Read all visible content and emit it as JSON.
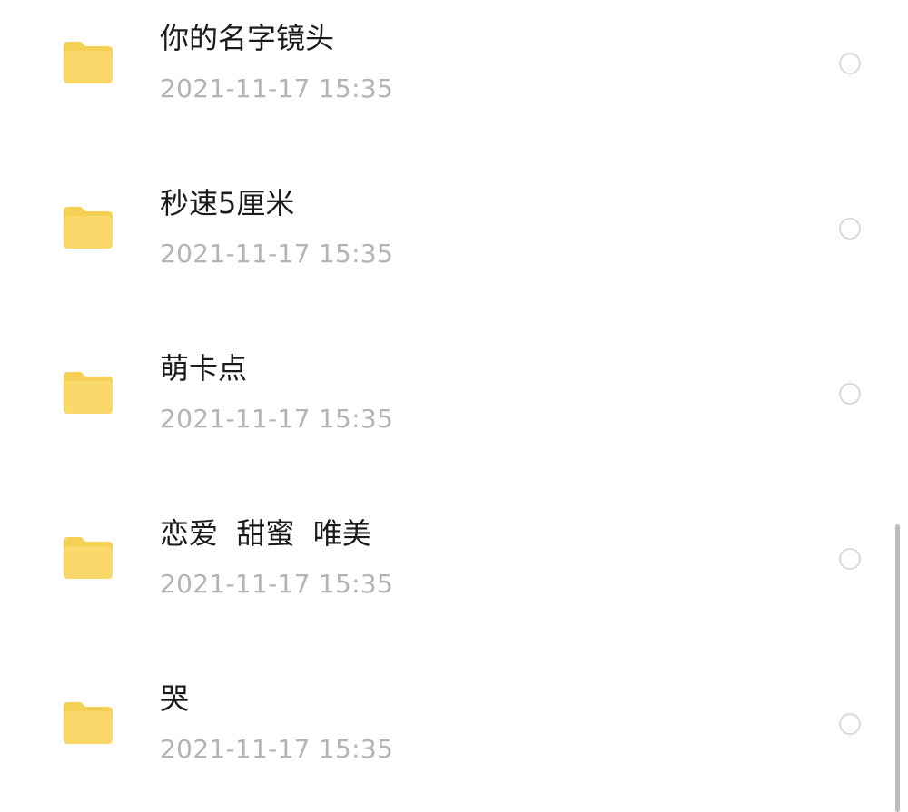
{
  "files": [
    {
      "name": "你的名字镜头",
      "date": "2021-11-17 15:35",
      "icon": "folder-icon"
    },
    {
      "name": "秒速5厘米",
      "date": "2021-11-17 15:35",
      "icon": "folder-icon"
    },
    {
      "name": "萌卡点",
      "date": "2021-11-17 15:35",
      "icon": "folder-icon"
    },
    {
      "name": "恋爱  甜蜜  唯美",
      "date": "2021-11-17 15:35",
      "icon": "folder-icon"
    },
    {
      "name": "哭",
      "date": "2021-11-17 15:35",
      "icon": "folder-icon"
    }
  ],
  "colors": {
    "folder": "#fad96a",
    "folder_tab": "#f6cf55",
    "name_text": "#1b1b1f",
    "date_text": "#b3b3b9",
    "radio_border": "#d9d9de",
    "scrollbar": "#bdbdc2"
  }
}
